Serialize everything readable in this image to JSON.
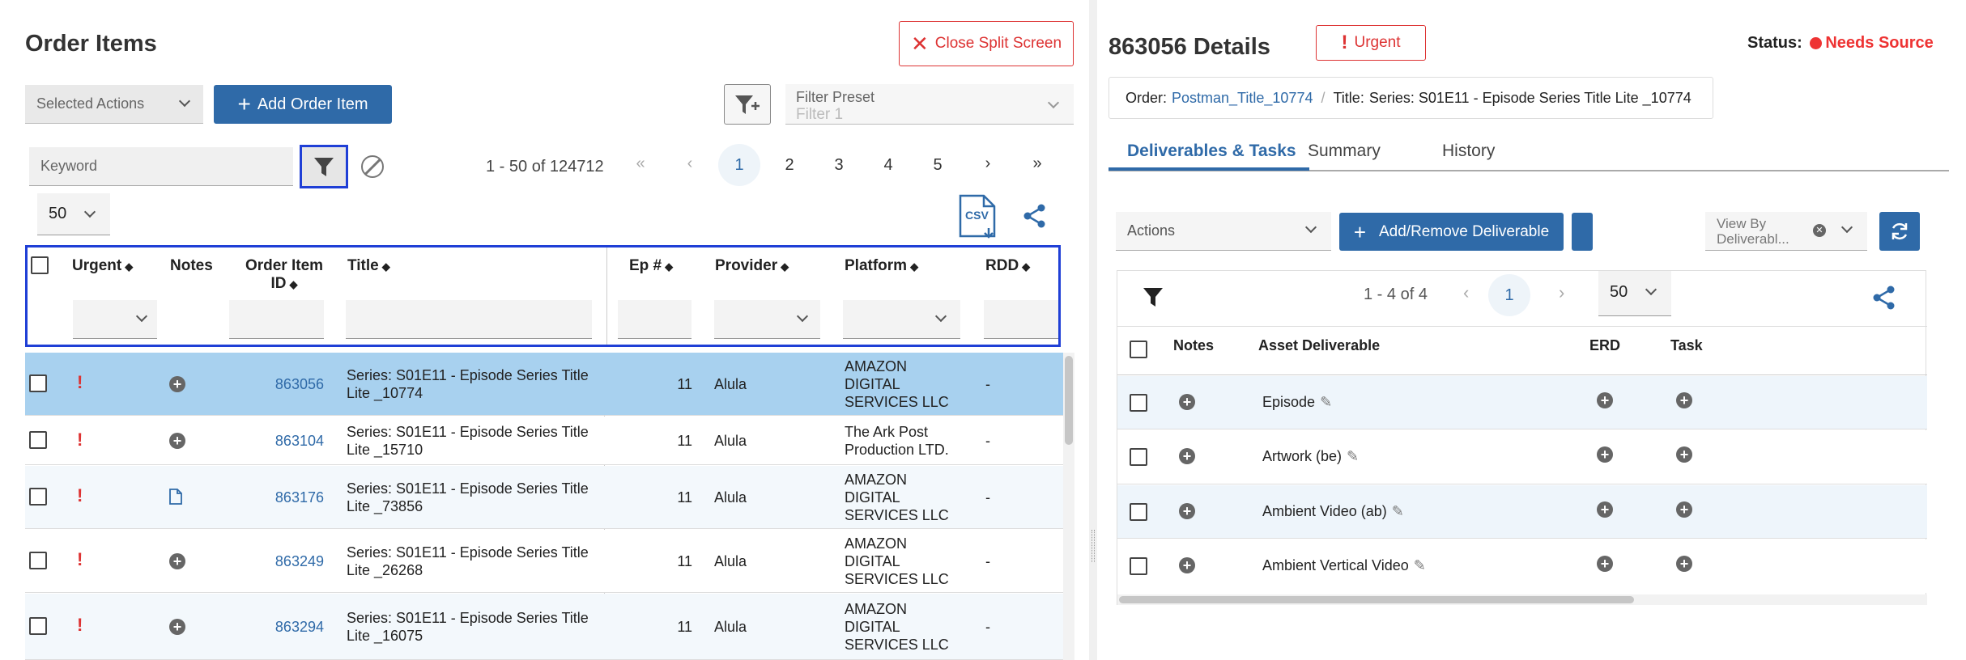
{
  "left": {
    "title": "Order Items",
    "close_split": "Close Split Screen",
    "selected_actions": "Selected Actions",
    "add_order_item": "Add Order Item",
    "filter_preset_label": "Filter Preset",
    "filter_preset_value": "Filter 1",
    "keyword_placeholder": "Keyword",
    "page_info": "1 - 50 of 124712",
    "pages": [
      "1",
      "2",
      "3",
      "4",
      "5"
    ],
    "page_size": "50",
    "csv": "CSV",
    "columns": {
      "urgent": "Urgent",
      "notes": "Notes",
      "order_item_id_1": "Order Item",
      "order_item_id_2": "ID",
      "title": "Title",
      "ep": "Ep #",
      "provider": "Provider",
      "platform": "Platform",
      "rdd": "RDD"
    },
    "rows": [
      {
        "id": "863056",
        "title1": "Series: S01E11 - Episode Series Title",
        "title2": "Lite _10774",
        "ep": "11",
        "provider": "Alula",
        "platform": [
          "AMAZON",
          "DIGITAL",
          "SERVICES LLC"
        ],
        "rdd": "-",
        "note": "plus"
      },
      {
        "id": "863104",
        "title1": "Series: S01E11 - Episode Series Title",
        "title2": "Lite _15710",
        "ep": "11",
        "provider": "Alula",
        "platform": [
          "The Ark Post",
          "Production LTD."
        ],
        "rdd": "-",
        "note": "plus"
      },
      {
        "id": "863176",
        "title1": "Series: S01E11 - Episode Series Title",
        "title2": "Lite _73856",
        "ep": "11",
        "provider": "Alula",
        "platform": [
          "AMAZON",
          "DIGITAL",
          "SERVICES LLC"
        ],
        "rdd": "-",
        "note": "doc"
      },
      {
        "id": "863249",
        "title1": "Series: S01E11 - Episode Series Title",
        "title2": "Lite _26268",
        "ep": "11",
        "provider": "Alula",
        "platform": [
          "AMAZON",
          "DIGITAL",
          "SERVICES LLC"
        ],
        "rdd": "-",
        "note": "plus"
      },
      {
        "id": "863294",
        "title1": "Series: S01E11 - Episode Series Title",
        "title2": "Lite _16075",
        "ep": "11",
        "provider": "Alula",
        "platform": [
          "AMAZON",
          "DIGITAL",
          "SERVICES LLC"
        ],
        "rdd": "-",
        "note": "plus"
      }
    ]
  },
  "right": {
    "title": "863056 Details",
    "urgent": "Urgent",
    "status_label": "Status:",
    "status_value": "Needs Source",
    "order_label": "Order:",
    "order_link": "Postman_Title_10774",
    "sep": "/",
    "title_label": "Title:",
    "title_value": "Series: S01E11 - Episode Series Title Lite _10774",
    "tabs": [
      "Deliverables & Tasks",
      "Summary",
      "History"
    ],
    "actions": "Actions",
    "add_remove": "Add/Remove Deliverable",
    "view_by_1": "View By",
    "view_by_2": "Deliverabl...",
    "page_info": "1 - 4 of 4",
    "page": "1",
    "page_size": "50",
    "columns": {
      "notes": "Notes",
      "asset": "Asset Deliverable",
      "erd": "ERD",
      "task": "Task"
    },
    "rows": [
      "Episode",
      "Artwork (be)",
      "Ambient Video (ab)",
      "Ambient Vertical Video"
    ]
  },
  "colors": {
    "accent": "#2f6aa8",
    "danger": "#d33",
    "selected_row": "#a8d1ef",
    "focus_outline": "#1f3fd6"
  }
}
